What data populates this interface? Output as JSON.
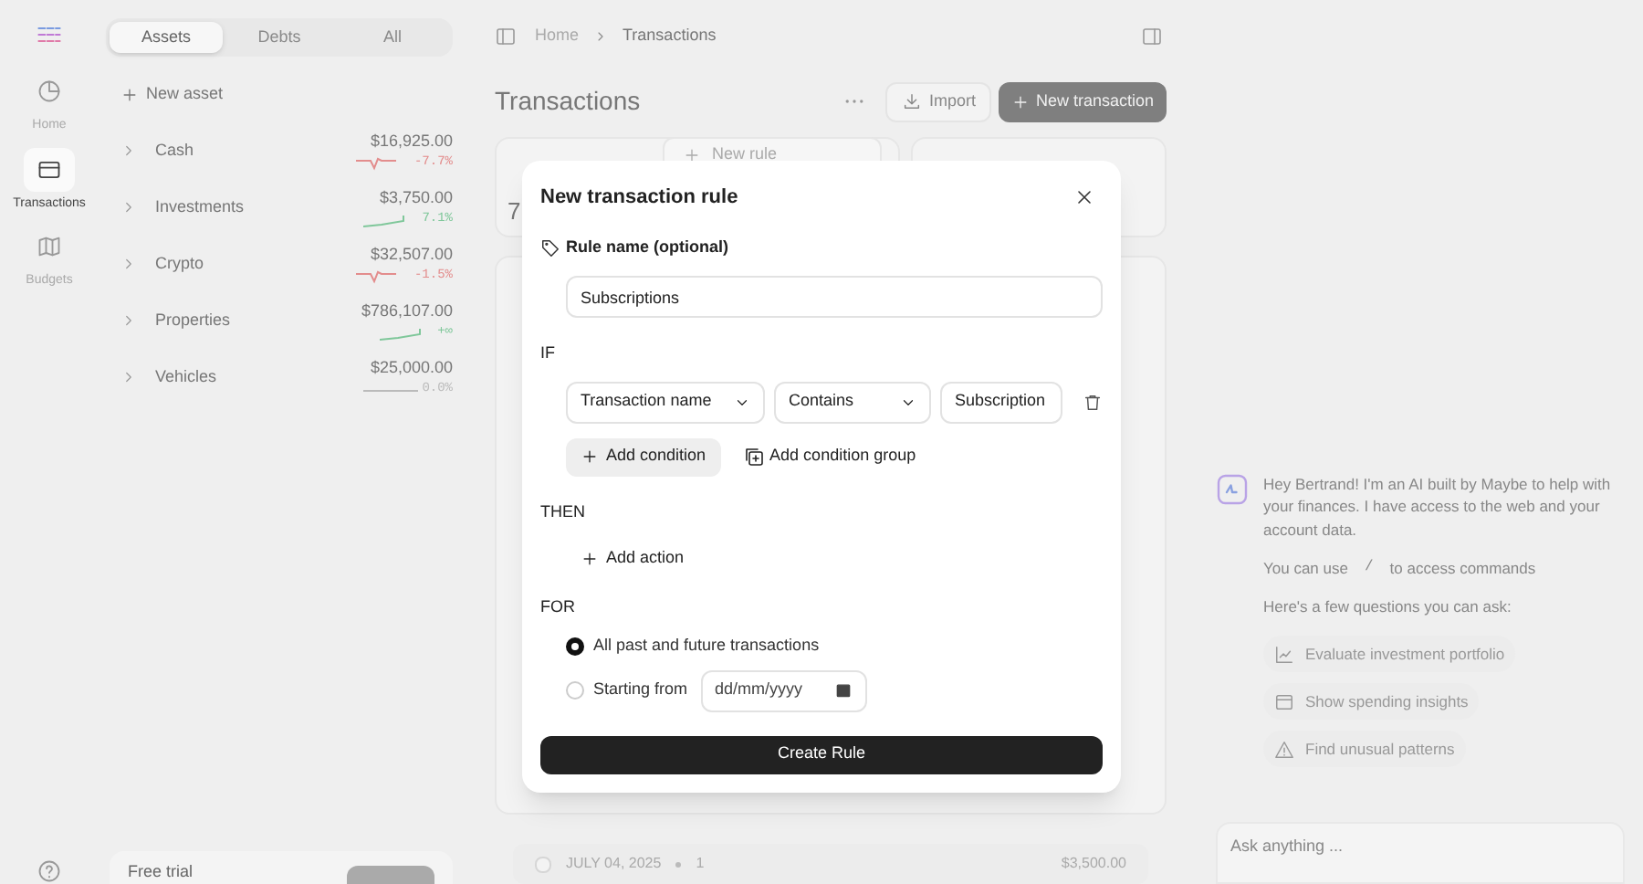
{
  "nav": {
    "items": [
      {
        "label": "Home",
        "kind": "home",
        "selected": false
      },
      {
        "label": "Transactions",
        "kind": "card",
        "selected": true
      },
      {
        "label": "Budgets",
        "kind": "map",
        "selected": false
      }
    ]
  },
  "sidebar": {
    "tabs": [
      {
        "label": "Assets",
        "selected": true
      },
      {
        "label": "Debts",
        "selected": false
      },
      {
        "label": "All",
        "selected": false
      }
    ],
    "new_asset": "New asset",
    "accounts": [
      {
        "name": "Cash",
        "balance": "$16,925.00",
        "change": "-7.7%",
        "kind": "down"
      },
      {
        "name": "Investments",
        "balance": "$3,750.00",
        "change": "7.1%",
        "kind": "up"
      },
      {
        "name": "Crypto",
        "balance": "$32,507.00",
        "change": "-1.5%",
        "kind": "down"
      },
      {
        "name": "Properties",
        "balance": "$786,107.00",
        "change": "+∞",
        "kind": "up"
      },
      {
        "name": "Vehicles",
        "balance": "$25,000.00",
        "change": "0.0%",
        "kind": "flat"
      }
    ],
    "trial": "Free trial"
  },
  "breadcrumb": [
    "Home",
    "Transactions"
  ],
  "page": {
    "title": "Transactions",
    "import": "Import",
    "new_transaction": "New transaction",
    "menu_item": "New rule",
    "stat_value": "7"
  },
  "group_row": {
    "checked": false,
    "date": "JULY 04, 2025",
    "count": "1",
    "amount": "$3,500.00"
  },
  "modal": {
    "title": "New transaction rule",
    "name_label": "Rule name (optional)",
    "name_value": "Subscriptions",
    "if_label": "IF",
    "condition": {
      "field": "Transaction name",
      "operator": "Contains",
      "value": "Subscription"
    },
    "add_condition": "Add condition",
    "add_group": "Add condition group",
    "then_label": "THEN",
    "add_action": "Add action",
    "for_label": "FOR",
    "options": [
      {
        "label": "All past and future transactions",
        "selected": true
      },
      {
        "label": "Starting from",
        "selected": false
      }
    ],
    "date_placeholder": "dd/mm/yyyy",
    "submit": "Create Rule"
  },
  "chat": {
    "message": "Hey Bertrand! I'm an AI built by Maybe to help with your finances. I have access to the web and your account data.",
    "commands": [
      "You can use",
      "/",
      "to access commands"
    ],
    "prompt": "Here's a few questions you can ask:",
    "suggestions": [
      {
        "label": "Evaluate investment portfolio",
        "kind": "chart"
      },
      {
        "label": "Show spending insights",
        "kind": "wallet"
      },
      {
        "label": "Find unusual patterns",
        "kind": "warning"
      }
    ],
    "placeholder": "Ask anything ..."
  }
}
